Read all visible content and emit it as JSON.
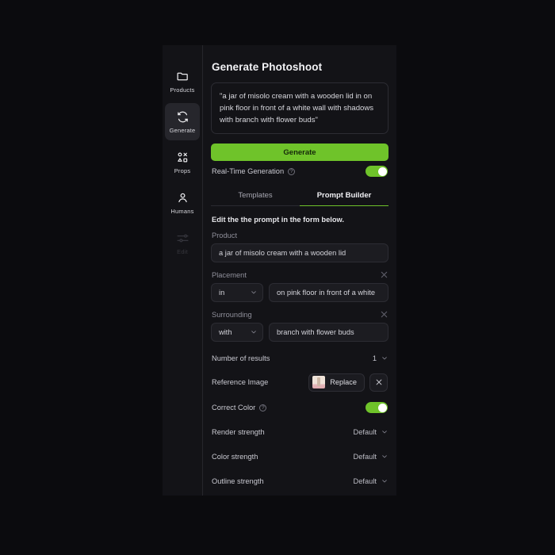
{
  "sidebar": {
    "items": [
      {
        "label": "Products",
        "icon": "folder-icon",
        "active": false,
        "disabled": false
      },
      {
        "label": "Generate",
        "icon": "refresh-icon",
        "active": true,
        "disabled": false
      },
      {
        "label": "Props",
        "icon": "shapes-icon",
        "active": false,
        "disabled": false
      },
      {
        "label": "Humans",
        "icon": "person-icon",
        "active": false,
        "disabled": false
      },
      {
        "label": "Edit",
        "icon": "sliders-icon",
        "active": false,
        "disabled": true
      }
    ]
  },
  "panel": {
    "title": "Generate Photoshoot",
    "prompt": "\"a jar of misolo cream with a wooden lid in on pink floor in front of a white wall with shadows with branch with flower buds\"",
    "generate_button": "Generate",
    "realtime": {
      "label": "Real-Time Generation",
      "help_icon": "question-icon",
      "enabled": true
    },
    "tabs": [
      {
        "label": "Templates",
        "active": false
      },
      {
        "label": "Prompt Builder",
        "active": true
      }
    ],
    "hint": "Edit the the prompt in the form below.",
    "fields": {
      "product": {
        "label": "Product",
        "value": "a jar of misolo cream with a wooden lid"
      },
      "placement": {
        "label": "Placement",
        "preposition": "in",
        "value": "on pink floor in front of a white",
        "clear_icon": "close-icon"
      },
      "surrounding": {
        "label": "Surrounding",
        "preposition": "with",
        "value": "branch with flower buds",
        "clear_icon": "close-icon"
      }
    },
    "number_of_results": {
      "label": "Number of results",
      "value": "1"
    },
    "reference_image": {
      "label": "Reference Image",
      "replace_label": "Replace",
      "thumbnail_icon": "image-thumbnail",
      "remove_icon": "close-icon"
    },
    "correct_color": {
      "label": "Correct Color",
      "help_icon": "question-icon",
      "enabled": true
    },
    "strengths": [
      {
        "label": "Render strength",
        "value": "Default"
      },
      {
        "label": "Color strength",
        "value": "Default"
      },
      {
        "label": "Outline strength",
        "value": "Default"
      }
    ]
  },
  "colors": {
    "accent_green": "#6fc32a",
    "panel_bg": "#131317",
    "page_bg": "#0b0b0e",
    "input_bg": "#1c1c21"
  }
}
